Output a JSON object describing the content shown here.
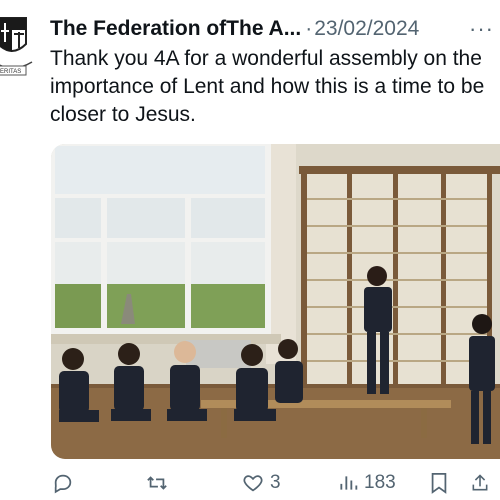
{
  "tweet": {
    "author": "The Federation ofThe A...",
    "separator": "·",
    "date": "23/02/2024",
    "more_label": "···",
    "text": "Thank you 4A for a wonderful assembly on the importance of Lent and how this is a time to be closer to Jesus."
  },
  "avatar": {
    "icon": "school-crest-icon",
    "motto": "ERITAS"
  },
  "media": {
    "description_icon": "assembly-photo"
  },
  "actions": {
    "reply_count": "",
    "retweet_count": "",
    "like_count": "3",
    "views_count": "183"
  },
  "colors": {
    "text": "#0f1419",
    "muted": "#536471"
  }
}
